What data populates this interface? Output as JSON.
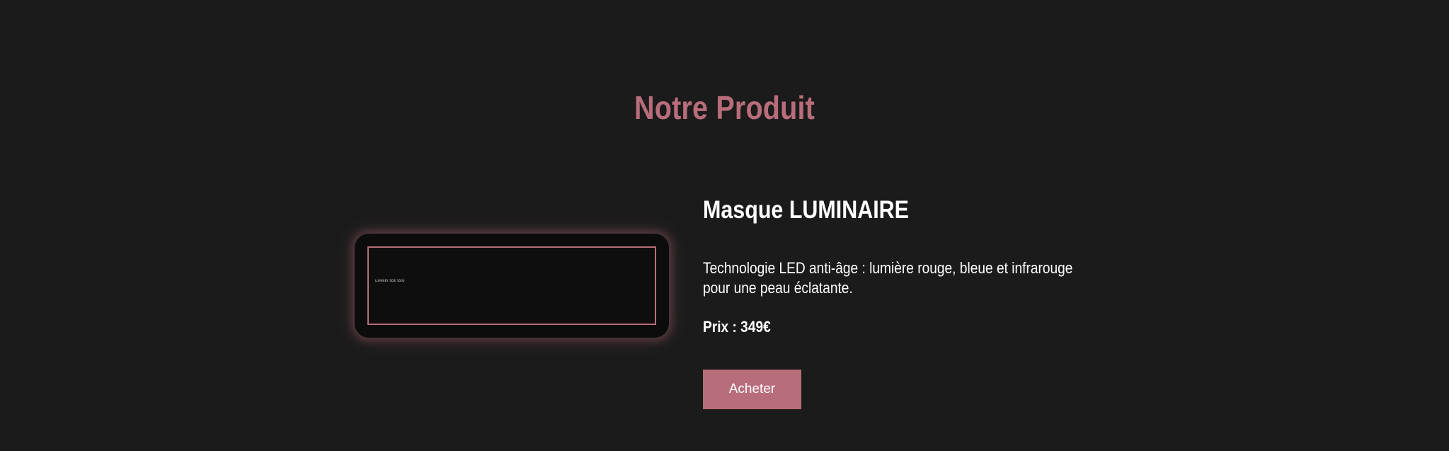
{
  "section": {
    "title": "Notre Produit"
  },
  "product": {
    "image_caption": "LUMINEY SDE 3000",
    "name": "Masque LUMINAIRE",
    "description": "Technologie LED anti-âge : lumière rouge, bleue et infrarouge pour une peau éclatante.",
    "price": "Prix : 349€",
    "buy_label": "Acheter"
  },
  "colors": {
    "background": "#1b1b1b",
    "accent": "#b86d7a",
    "card_background": "#0c0c0c",
    "text": "#ffffff"
  }
}
